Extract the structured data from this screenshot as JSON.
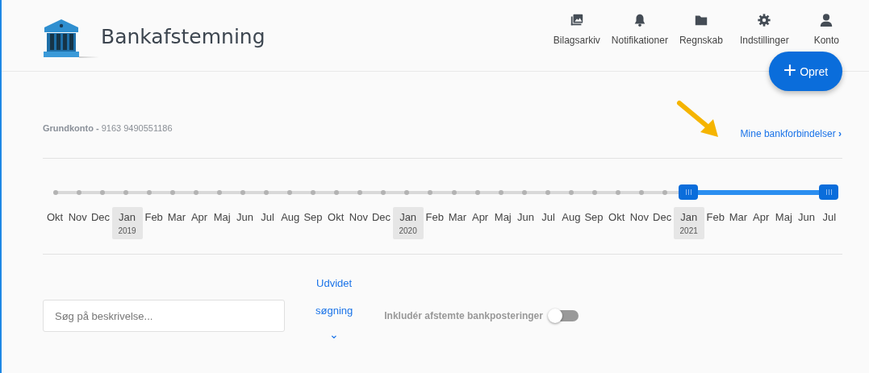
{
  "header": {
    "title": "Bankafstemning",
    "nav": [
      {
        "kind": "photos",
        "label": "Bilagsarkiv"
      },
      {
        "kind": "bell",
        "label": "Notifikationer"
      },
      {
        "kind": "folder",
        "label": "Regnskab"
      },
      {
        "kind": "gear",
        "label": "Indstillinger"
      },
      {
        "kind": "user",
        "label": "Konto"
      }
    ],
    "create_button": {
      "icon": "+",
      "label": "Opret"
    }
  },
  "account": {
    "name": "Grundkonto -",
    "number": "9163 9490551186"
  },
  "bank_link": {
    "label": "Mine bankforbindelser",
    "chevron": "›"
  },
  "timeline": {
    "months": [
      {
        "label": "Okt",
        "in_range": false
      },
      {
        "label": "Nov",
        "in_range": false
      },
      {
        "label": "Dec",
        "in_range": false
      },
      {
        "label": "Jan",
        "year": "2019",
        "in_range": false
      },
      {
        "label": "Feb",
        "in_range": false
      },
      {
        "label": "Mar",
        "in_range": false
      },
      {
        "label": "Apr",
        "in_range": false
      },
      {
        "label": "Maj",
        "in_range": false
      },
      {
        "label": "Jun",
        "in_range": false
      },
      {
        "label": "Jul",
        "in_range": false
      },
      {
        "label": "Aug",
        "in_range": false
      },
      {
        "label": "Sep",
        "in_range": false
      },
      {
        "label": "Okt",
        "in_range": false
      },
      {
        "label": "Nov",
        "in_range": false
      },
      {
        "label": "Dec",
        "in_range": false
      },
      {
        "label": "Jan",
        "year": "2020",
        "in_range": false
      },
      {
        "label": "Feb",
        "in_range": false
      },
      {
        "label": "Mar",
        "in_range": false
      },
      {
        "label": "Apr",
        "in_range": false
      },
      {
        "label": "Maj",
        "in_range": false
      },
      {
        "label": "Jun",
        "in_range": false
      },
      {
        "label": "Jul",
        "in_range": false
      },
      {
        "label": "Aug",
        "in_range": false
      },
      {
        "label": "Sep",
        "in_range": false
      },
      {
        "label": "Okt",
        "in_range": false
      },
      {
        "label": "Nov",
        "in_range": false
      },
      {
        "label": "Dec",
        "in_range": false
      },
      {
        "label": "Jan",
        "year": "2021",
        "in_range": true
      },
      {
        "label": "Feb",
        "in_range": true
      },
      {
        "label": "Mar",
        "in_range": true
      },
      {
        "label": "Apr",
        "in_range": true
      },
      {
        "label": "Maj",
        "in_range": true
      },
      {
        "label": "Jun",
        "in_range": true
      },
      {
        "label": "Jul",
        "in_range": true
      }
    ]
  },
  "search": {
    "placeholder": "Søg på beskrivelse..."
  },
  "advanced_search": {
    "line1": "Udvidet",
    "line2": "søgning",
    "chevron": "⌄"
  },
  "include_reconciled": {
    "label": "Inkludér afstemte bankposteringer",
    "on": false
  }
}
